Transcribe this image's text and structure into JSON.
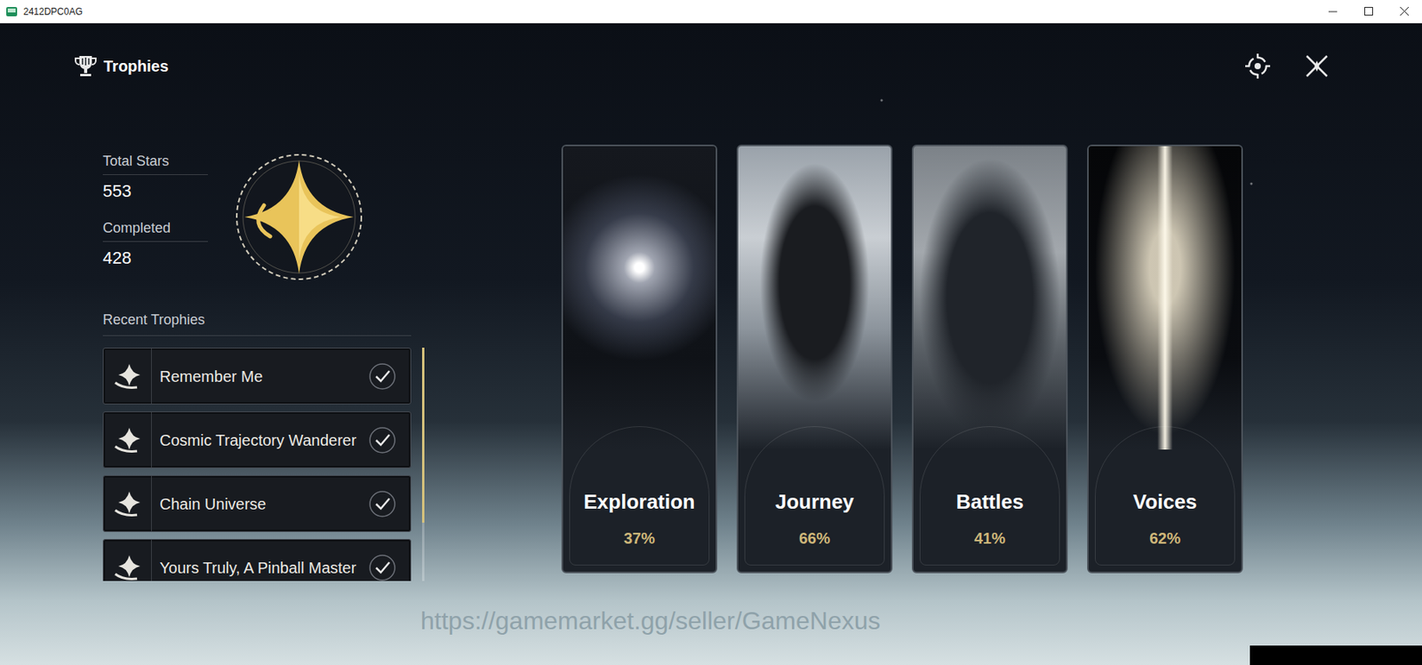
{
  "window": {
    "title": "2412DPC0AG"
  },
  "header": {
    "title": "Trophies"
  },
  "stats": [
    {
      "label": "Total Stars",
      "value": "553"
    },
    {
      "label": "Completed",
      "value": "428"
    }
  ],
  "recent": {
    "title": "Recent Trophies",
    "items": [
      {
        "label": "Remember Me",
        "completed": true
      },
      {
        "label": "Cosmic Trajectory Wanderer",
        "completed": true
      },
      {
        "label": "Chain Universe",
        "completed": true
      },
      {
        "label": "Yours Truly, A Pinball Master",
        "completed": true
      }
    ]
  },
  "categories": [
    {
      "label": "Exploration",
      "percent": "37%"
    },
    {
      "label": "Journey",
      "percent": "66%"
    },
    {
      "label": "Battles",
      "percent": "41%"
    },
    {
      "label": "Voices",
      "percent": "62%"
    }
  ],
  "watermark": "https://gamemarket.gg/seller/GameNexus"
}
